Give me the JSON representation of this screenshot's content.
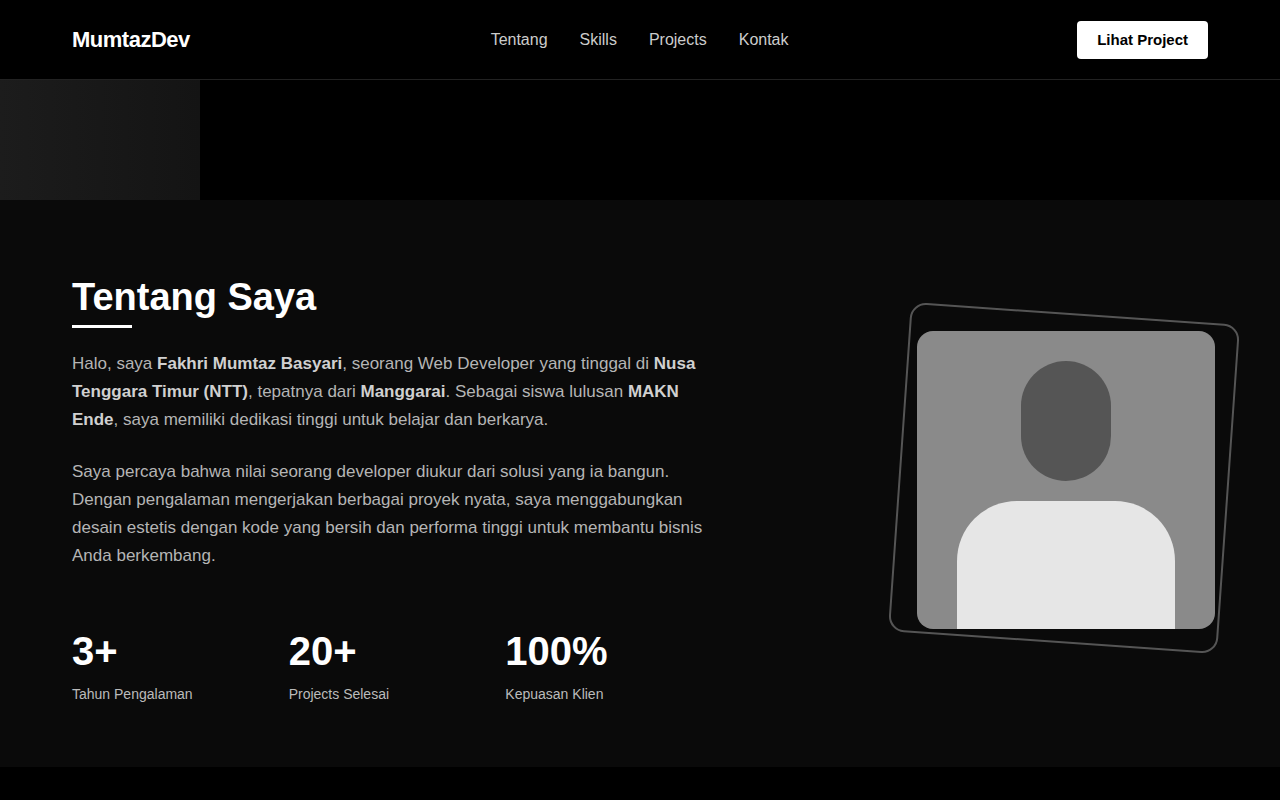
{
  "header": {
    "logo": "MumtazDev",
    "nav": [
      "Tentang",
      "Skills",
      "Projects",
      "Kontak"
    ],
    "cta": "Lihat Project"
  },
  "about": {
    "title": "Tentang Saya",
    "paragraphs": [
      [
        {
          "text": "Halo, saya ",
          "bold": false
        },
        {
          "text": "Fakhri Mumtaz Basyari",
          "bold": true
        },
        {
          "text": ", seorang Web Developer yang tinggal di ",
          "bold": false
        },
        {
          "text": "Nusa Tenggara Timur (NTT)",
          "bold": true
        },
        {
          "text": ", tepatnya dari ",
          "bold": false
        },
        {
          "text": "Manggarai",
          "bold": true
        },
        {
          "text": ". Sebagai siswa lulusan ",
          "bold": false
        },
        {
          "text": "MAKN Ende",
          "bold": true
        },
        {
          "text": ", saya memiliki dedikasi tinggi untuk belajar dan berkarya.",
          "bold": false
        }
      ],
      [
        {
          "text": "Saya percaya bahwa nilai seorang developer diukur dari solusi yang ia bangun. Dengan pengalaman mengerjakan berbagai proyek nyata, saya menggabungkan desain estetis dengan kode yang bersih dan performa tinggi untuk membantu bisnis Anda berkembang.",
          "bold": false
        }
      ]
    ],
    "stats": [
      {
        "value": "3+",
        "label": "Tahun Pengalaman"
      },
      {
        "value": "20+",
        "label": "Projects Selesai"
      },
      {
        "value": "100%",
        "label": "Kepuasan Klien"
      }
    ]
  }
}
